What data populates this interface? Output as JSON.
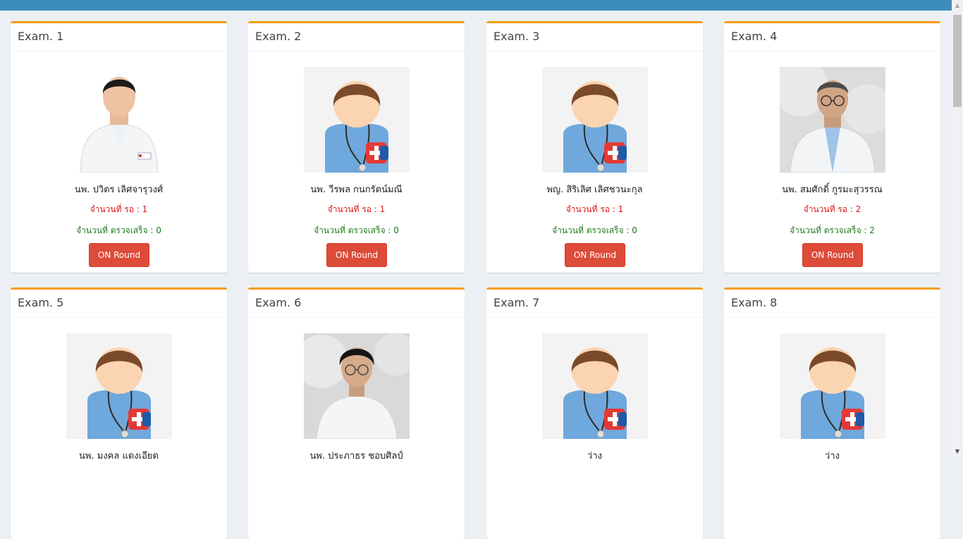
{
  "cards": [
    {
      "title": "Exam. 1",
      "doctor": "นพ. ปวิตร เลิศจารุวงศ์",
      "photo": "photo-man-young-icon",
      "waiting": "จำนวนที่ รอ : 1",
      "done": "จำนวนที่ ตรวจเสร็จ : 0",
      "button": "ON Round"
    },
    {
      "title": "Exam. 2",
      "doctor": "นพ. วีรพล กนกรัตน์มณี",
      "photo": "doctor-avatar-icon",
      "waiting": "จำนวนที่ รอ : 1",
      "done": "จำนวนที่ ตรวจเสร็จ : 0",
      "button": "ON Round"
    },
    {
      "title": "Exam. 3",
      "doctor": "พญ. สิริเลิศ เลิศชวนะกุล",
      "photo": "doctor-avatar-icon",
      "waiting": "จำนวนที่ รอ : 1",
      "done": "จำนวนที่ ตรวจเสร็จ : 0",
      "button": "ON Round"
    },
    {
      "title": "Exam. 4",
      "doctor": "นพ. สมศักดิ์ กูรมะสุวรรณ",
      "photo": "photo-man-glasses-icon",
      "waiting": "จำนวนที่ รอ : 2",
      "done": "จำนวนที่ ตรวจเสร็จ : 2",
      "button": "ON Round"
    },
    {
      "title": "Exam. 5",
      "doctor": "นพ. มงคล แดงเอียด",
      "photo": "doctor-avatar-icon",
      "waiting": "",
      "done": "",
      "button": ""
    },
    {
      "title": "Exam. 6",
      "doctor": "นพ. ประภาธร ชอบศิลป์",
      "photo": "photo-man-glasses-icon",
      "waiting": "",
      "done": "",
      "button": ""
    },
    {
      "title": "Exam. 7",
      "doctor": "ว่าง",
      "photo": "doctor-avatar-icon",
      "waiting": "",
      "done": "",
      "button": ""
    },
    {
      "title": "Exam. 8",
      "doctor": "ว่าง",
      "photo": "doctor-avatar-icon",
      "waiting": "",
      "done": "",
      "button": ""
    }
  ]
}
